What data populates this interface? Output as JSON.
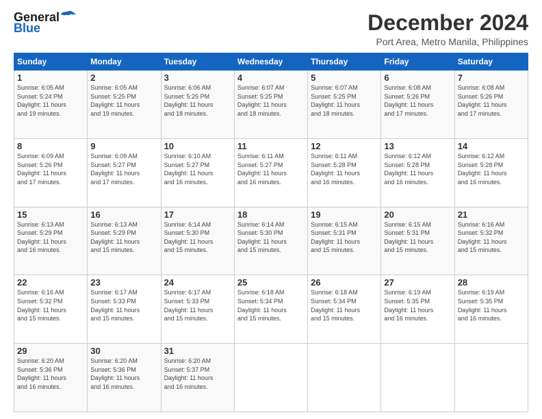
{
  "header": {
    "logo_general": "General",
    "logo_blue": "Blue",
    "title": "December 2024",
    "subtitle": "Port Area, Metro Manila, Philippines"
  },
  "calendar": {
    "days_of_week": [
      "Sunday",
      "Monday",
      "Tuesday",
      "Wednesday",
      "Thursday",
      "Friday",
      "Saturday"
    ],
    "weeks": [
      [
        null,
        {
          "day": 2,
          "sunrise": "6:05 AM",
          "sunset": "5:25 PM",
          "daylight": "11 hours and 19 minutes."
        },
        {
          "day": 3,
          "sunrise": "6:06 AM",
          "sunset": "5:25 PM",
          "daylight": "11 hours and 18 minutes."
        },
        {
          "day": 4,
          "sunrise": "6:07 AM",
          "sunset": "5:25 PM",
          "daylight": "11 hours and 18 minutes."
        },
        {
          "day": 5,
          "sunrise": "6:07 AM",
          "sunset": "5:25 PM",
          "daylight": "11 hours and 18 minutes."
        },
        {
          "day": 6,
          "sunrise": "6:08 AM",
          "sunset": "5:26 PM",
          "daylight": "11 hours and 17 minutes."
        },
        {
          "day": 7,
          "sunrise": "6:08 AM",
          "sunset": "5:26 PM",
          "daylight": "11 hours and 17 minutes."
        }
      ],
      [
        {
          "day": 1,
          "sunrise": "6:05 AM",
          "sunset": "5:24 PM",
          "daylight": "11 hours and 19 minutes."
        },
        null,
        null,
        null,
        null,
        null,
        null
      ],
      [
        {
          "day": 8,
          "sunrise": "6:09 AM",
          "sunset": "5:26 PM",
          "daylight": "11 hours and 17 minutes."
        },
        {
          "day": 9,
          "sunrise": "6:09 AM",
          "sunset": "5:27 PM",
          "daylight": "11 hours and 17 minutes."
        },
        {
          "day": 10,
          "sunrise": "6:10 AM",
          "sunset": "5:27 PM",
          "daylight": "11 hours and 16 minutes."
        },
        {
          "day": 11,
          "sunrise": "6:11 AM",
          "sunset": "5:27 PM",
          "daylight": "11 hours and 16 minutes."
        },
        {
          "day": 12,
          "sunrise": "6:11 AM",
          "sunset": "5:28 PM",
          "daylight": "11 hours and 16 minutes."
        },
        {
          "day": 13,
          "sunrise": "6:12 AM",
          "sunset": "5:28 PM",
          "daylight": "11 hours and 16 minutes."
        },
        {
          "day": 14,
          "sunrise": "6:12 AM",
          "sunset": "5:28 PM",
          "daylight": "11 hours and 16 minutes."
        }
      ],
      [
        {
          "day": 15,
          "sunrise": "6:13 AM",
          "sunset": "5:29 PM",
          "daylight": "11 hours and 16 minutes."
        },
        {
          "day": 16,
          "sunrise": "6:13 AM",
          "sunset": "5:29 PM",
          "daylight": "11 hours and 15 minutes."
        },
        {
          "day": 17,
          "sunrise": "6:14 AM",
          "sunset": "5:30 PM",
          "daylight": "11 hours and 15 minutes."
        },
        {
          "day": 18,
          "sunrise": "6:14 AM",
          "sunset": "5:30 PM",
          "daylight": "11 hours and 15 minutes."
        },
        {
          "day": 19,
          "sunrise": "6:15 AM",
          "sunset": "5:31 PM",
          "daylight": "11 hours and 15 minutes."
        },
        {
          "day": 20,
          "sunrise": "6:15 AM",
          "sunset": "5:31 PM",
          "daylight": "11 hours and 15 minutes."
        },
        {
          "day": 21,
          "sunrise": "6:16 AM",
          "sunset": "5:32 PM",
          "daylight": "11 hours and 15 minutes."
        }
      ],
      [
        {
          "day": 22,
          "sunrise": "6:16 AM",
          "sunset": "5:32 PM",
          "daylight": "11 hours and 15 minutes."
        },
        {
          "day": 23,
          "sunrise": "6:17 AM",
          "sunset": "5:33 PM",
          "daylight": "11 hours and 15 minutes."
        },
        {
          "day": 24,
          "sunrise": "6:17 AM",
          "sunset": "5:33 PM",
          "daylight": "11 hours and 15 minutes."
        },
        {
          "day": 25,
          "sunrise": "6:18 AM",
          "sunset": "5:34 PM",
          "daylight": "11 hours and 15 minutes."
        },
        {
          "day": 26,
          "sunrise": "6:18 AM",
          "sunset": "5:34 PM",
          "daylight": "11 hours and 15 minutes."
        },
        {
          "day": 27,
          "sunrise": "6:19 AM",
          "sunset": "5:35 PM",
          "daylight": "11 hours and 16 minutes."
        },
        {
          "day": 28,
          "sunrise": "6:19 AM",
          "sunset": "5:35 PM",
          "daylight": "11 hours and 16 minutes."
        }
      ],
      [
        {
          "day": 29,
          "sunrise": "6:20 AM",
          "sunset": "5:36 PM",
          "daylight": "11 hours and 16 minutes."
        },
        {
          "day": 30,
          "sunrise": "6:20 AM",
          "sunset": "5:36 PM",
          "daylight": "11 hours and 16 minutes."
        },
        {
          "day": 31,
          "sunrise": "6:20 AM",
          "sunset": "5:37 PM",
          "daylight": "11 hours and 16 minutes."
        },
        null,
        null,
        null,
        null
      ]
    ]
  }
}
